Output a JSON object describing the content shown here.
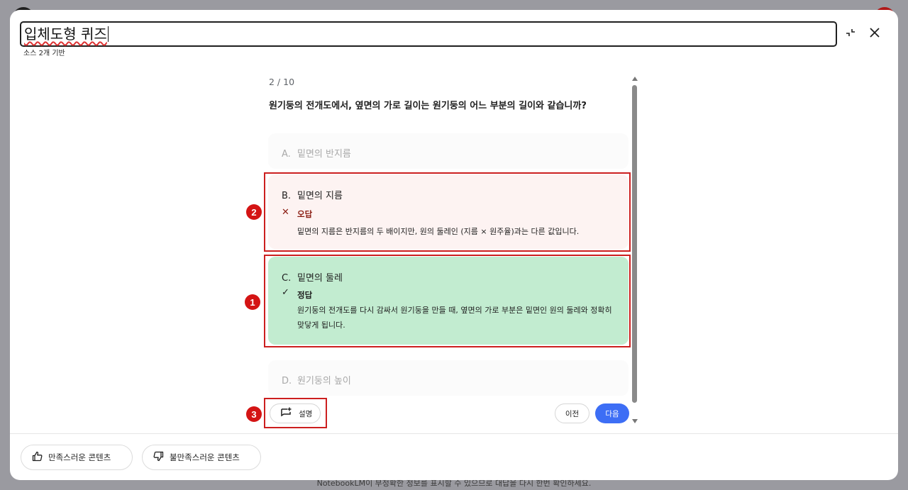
{
  "footer": {
    "note": "NotebookLM이 부정확한 정보를 표시할 수 있으므로 대답을 다시 한번 확인하세요."
  },
  "header": {
    "title": "입체도형 퀴즈",
    "subtitle": "소스 2개 기반",
    "collapse_icon": "collapse-icon",
    "close_icon": "close-icon"
  },
  "quiz": {
    "counter": "2 / 10",
    "question": "원기둥의 전개도에서, 옆면의 가로 길이는 원기둥의 어느 부분의 길이와 같습니까?",
    "options": [
      {
        "letter": "A.",
        "text": "밑면의 반지름",
        "state": "unselected"
      },
      {
        "letter": "B.",
        "text": "밑면의 지름",
        "state": "wrong",
        "verdict": "오답",
        "explanation": "밑면의 지름은 반지름의 두 배이지만, 원의 둘레인 (지름 × 원주율)과는 다른 값입니다."
      },
      {
        "letter": "C.",
        "text": "밑면의 둘레",
        "state": "correct",
        "verdict": "정답",
        "explanation": "원기둥의 전개도를 다시 감싸서 원기둥을 만들 때, 옆면의 가로 부분은 밑면인 원의 둘레와 정확히 맞닿게 됩니다."
      },
      {
        "letter": "D.",
        "text": "원기둥의 높이",
        "state": "unselected"
      }
    ],
    "explain_button": "설명",
    "prev_button": "이전",
    "next_button": "다음"
  },
  "annotations": [
    "1",
    "2",
    "3"
  ],
  "feedback": {
    "good_label": "만족스러운 콘텐츠",
    "bad_label": "불만족스러운 콘텐츠"
  },
  "colors": {
    "accent": "#3d6ef5",
    "correct_bg": "#c2ecd0",
    "wrong_bg": "#fdf3f2",
    "wrong_text": "#8a1c12",
    "annotation": "#d41414"
  }
}
